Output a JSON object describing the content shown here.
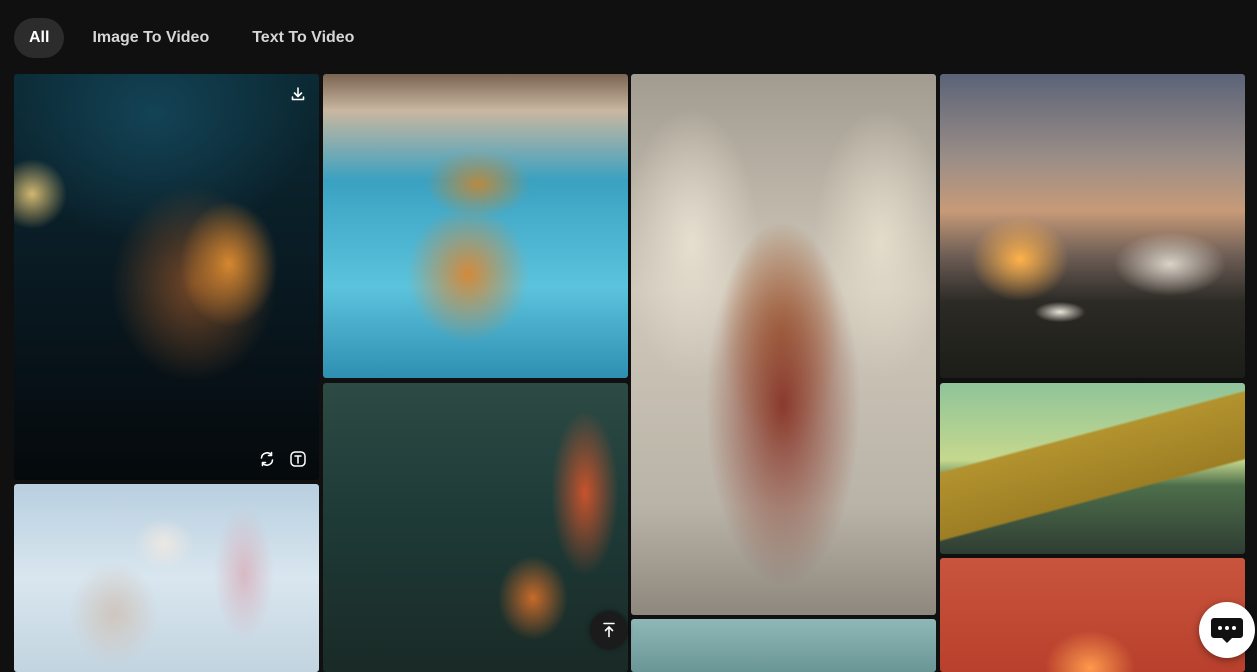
{
  "tabs": [
    {
      "label": "All",
      "active": true
    },
    {
      "label": "Image To Video",
      "active": false
    },
    {
      "label": "Text To Video",
      "active": false
    }
  ],
  "gallery": {
    "items": [
      {
        "id": "portrait-glasses",
        "icon": "none"
      },
      {
        "id": "cat-cowboy-hat-pool",
        "icon": "none"
      },
      {
        "id": "armored-angel",
        "icon": "none"
      },
      {
        "id": "burning-house-car",
        "icon": "none"
      },
      {
        "id": "neon-sign-headphones",
        "icon": "none"
      },
      {
        "id": "cardboard-box-powerline",
        "icon": "none"
      },
      {
        "id": "white-hair-dolphin",
        "icon": "none"
      },
      {
        "id": "teal-sky",
        "icon": "none"
      },
      {
        "id": "red-fire-glow",
        "icon": "none"
      }
    ],
    "hover_actions": [
      "download-icon",
      "regenerate-icon",
      "text-icon"
    ]
  },
  "floating": {
    "scroll_top_icon": "arrow-up-to-line-icon",
    "chat_icon": "chat-bubble-icon"
  },
  "colors": {
    "background": "#101010",
    "active_tab": "#2c2c2c",
    "text": "#d6d6d6"
  }
}
